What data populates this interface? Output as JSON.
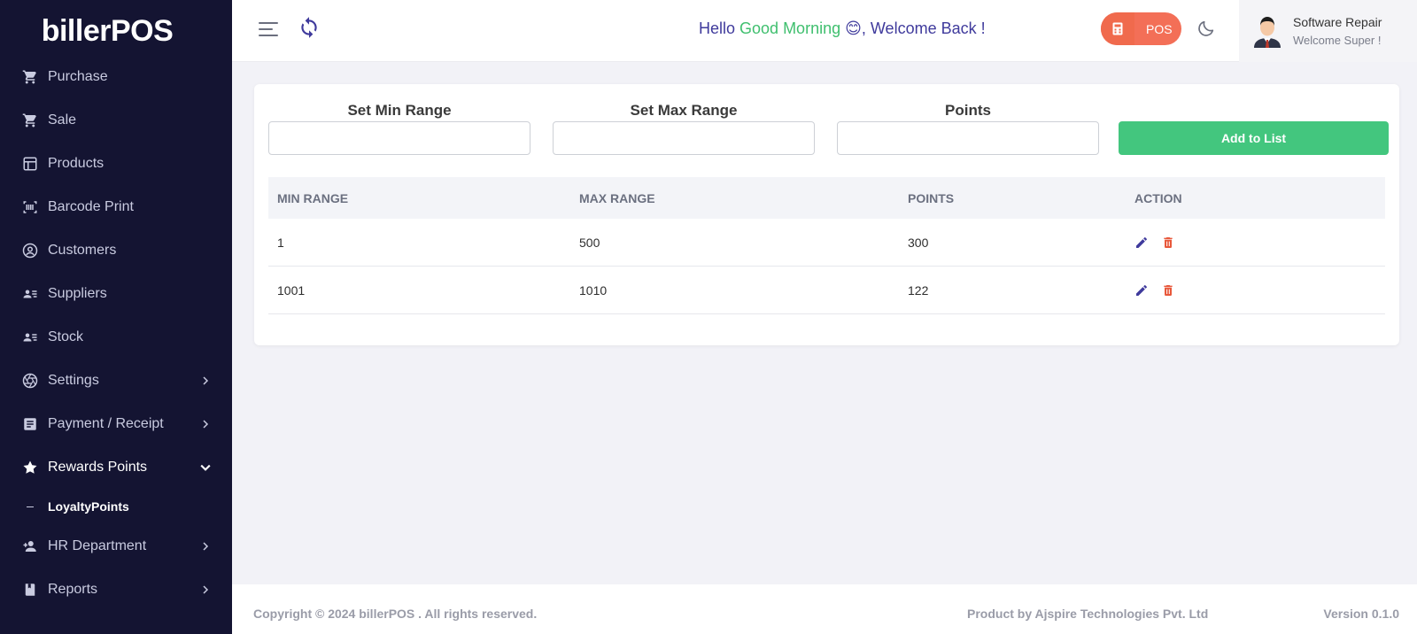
{
  "app": {
    "logo_text": "billerPOS"
  },
  "header": {
    "greeting_prefix": "Hello ",
    "greeting_highlight": "Good Morning",
    "greeting_emoji": "😊",
    "greeting_suffix": ", Welcome Back !",
    "pos_label": "POS",
    "user_name": "Software Repair",
    "user_sub": "Welcome Super !"
  },
  "sidebar": {
    "items": [
      {
        "label": "Purchase",
        "icon": "cart-icon"
      },
      {
        "label": "Sale",
        "icon": "cart-icon"
      },
      {
        "label": "Products",
        "icon": "layout-icon"
      },
      {
        "label": "Barcode Print",
        "icon": "barcode-icon"
      },
      {
        "label": "Customers",
        "icon": "user-circle-icon"
      },
      {
        "label": "Suppliers",
        "icon": "id-card-icon"
      },
      {
        "label": "Stock",
        "icon": "id-card-icon"
      },
      {
        "label": "Settings",
        "icon": "aperture-icon"
      },
      {
        "label": "Payment / Receipt",
        "icon": "receipt-icon"
      },
      {
        "label": "Rewards Points",
        "icon": "star-icon"
      },
      {
        "label": "HR Department",
        "icon": "user-plus-icon"
      },
      {
        "label": "Reports",
        "icon": "book-icon"
      }
    ],
    "sub_items": [
      {
        "label": "LoyaltyPoints"
      }
    ]
  },
  "form": {
    "min_label": "Set Min Range",
    "max_label": "Set Max Range",
    "points_label": "Points",
    "min_value": "",
    "max_value": "",
    "points_value": "",
    "add_button": "Add to List"
  },
  "table": {
    "headers": [
      "MIN RANGE",
      "MAX RANGE",
      "POINTS",
      "ACTION"
    ],
    "rows": [
      {
        "min": "1",
        "max": "500",
        "points": "300"
      },
      {
        "min": "1001",
        "max": "1010",
        "points": "122"
      }
    ]
  },
  "footer": {
    "copyright": "Copyright © 2024 billerPOS . All rights reserved.",
    "product_by": "Product by Ajspire Technologies Pvt. Ltd",
    "version": "Version 0.1.0"
  },
  "colors": {
    "sidebar_bg": "#141432",
    "accent_green": "#43c67e",
    "accent_orange": "#f36f57",
    "accent_purple": "#3f3a9c"
  }
}
